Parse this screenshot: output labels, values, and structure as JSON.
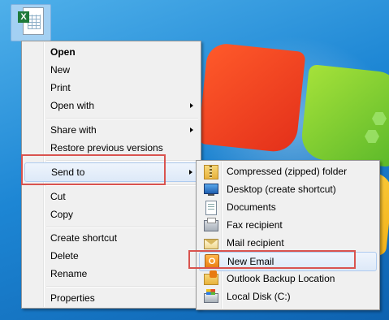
{
  "context_menu": {
    "items": [
      {
        "label": "Open",
        "bold": true,
        "submenu": false
      },
      {
        "label": "New",
        "bold": false,
        "submenu": false
      },
      {
        "label": "Print",
        "bold": false,
        "submenu": false
      },
      {
        "label": "Open with",
        "bold": false,
        "submenu": true
      },
      {
        "label": "Share with",
        "bold": false,
        "submenu": true
      },
      {
        "label": "Restore previous versions",
        "bold": false,
        "submenu": false
      },
      {
        "label": "Send to",
        "bold": false,
        "submenu": true,
        "highlighted": true
      },
      {
        "label": "Cut",
        "bold": false,
        "submenu": false
      },
      {
        "label": "Copy",
        "bold": false,
        "submenu": false
      },
      {
        "label": "Create shortcut",
        "bold": false,
        "submenu": false
      },
      {
        "label": "Delete",
        "bold": false,
        "submenu": false
      },
      {
        "label": "Rename",
        "bold": false,
        "submenu": false
      },
      {
        "label": "Properties",
        "bold": false,
        "submenu": false
      }
    ]
  },
  "send_to_menu": {
    "items": [
      {
        "label": "Compressed (zipped) folder",
        "icon": "zip-folder-icon"
      },
      {
        "label": "Desktop (create shortcut)",
        "icon": "desktop-icon"
      },
      {
        "label": "Documents",
        "icon": "documents-icon"
      },
      {
        "label": "Fax recipient",
        "icon": "fax-icon"
      },
      {
        "label": "Mail recipient",
        "icon": "mail-icon"
      },
      {
        "label": "New Email",
        "icon": "outlook-icon",
        "highlighted": true
      },
      {
        "label": "Outlook Backup Location",
        "icon": "outlook-folder-icon"
      },
      {
        "label": "Local Disk (C:)",
        "icon": "local-disk-icon"
      }
    ]
  },
  "desktop_file": {
    "icon": "excel-file-icon"
  },
  "colors": {
    "annotation_box": "#d9534f",
    "highlight_border": "#aecbf0"
  }
}
